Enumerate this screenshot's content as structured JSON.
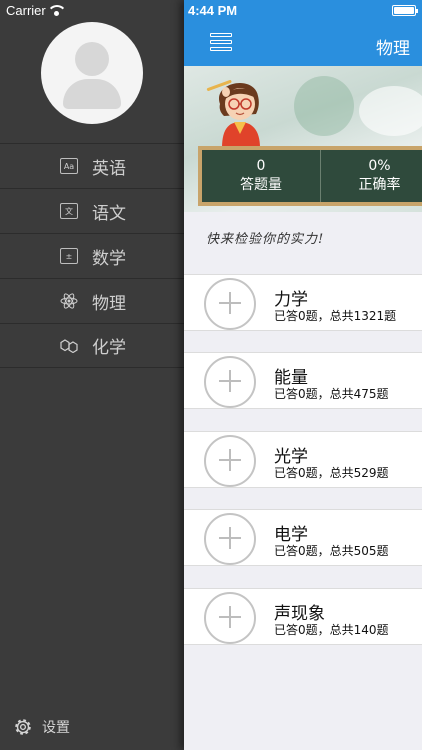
{
  "status_bar": {
    "carrier": "Carrier",
    "time": "4:44 PM"
  },
  "drawer": {
    "menu": [
      {
        "label": "英语",
        "icon": "english-book-icon"
      },
      {
        "label": "语文",
        "icon": "chinese-book-icon"
      },
      {
        "label": "数学",
        "icon": "math-icon"
      },
      {
        "label": "物理",
        "icon": "atom-icon"
      },
      {
        "label": "化学",
        "icon": "chemistry-icon"
      }
    ],
    "settings_label": "设置"
  },
  "header": {
    "title": "物理"
  },
  "stats": {
    "answered_value": "0",
    "answered_label": "答题量",
    "accuracy_value": "0%",
    "accuracy_label": "正确率"
  },
  "slogan": "快来检验你的实力!",
  "topics": [
    {
      "name": "力学",
      "progress": "已答0题，总共1321题"
    },
    {
      "name": "能量",
      "progress": "已答0题，总共475题"
    },
    {
      "name": "光学",
      "progress": "已答0题，总共529题"
    },
    {
      "name": "电学",
      "progress": "已答0题，总共505题"
    },
    {
      "name": "声现象",
      "progress": "已答0题，总共140题"
    }
  ],
  "colors": {
    "nav_blue": "#2a8fde",
    "drawer_bg": "#3b3b3b",
    "board_green": "#2f4a3c"
  }
}
